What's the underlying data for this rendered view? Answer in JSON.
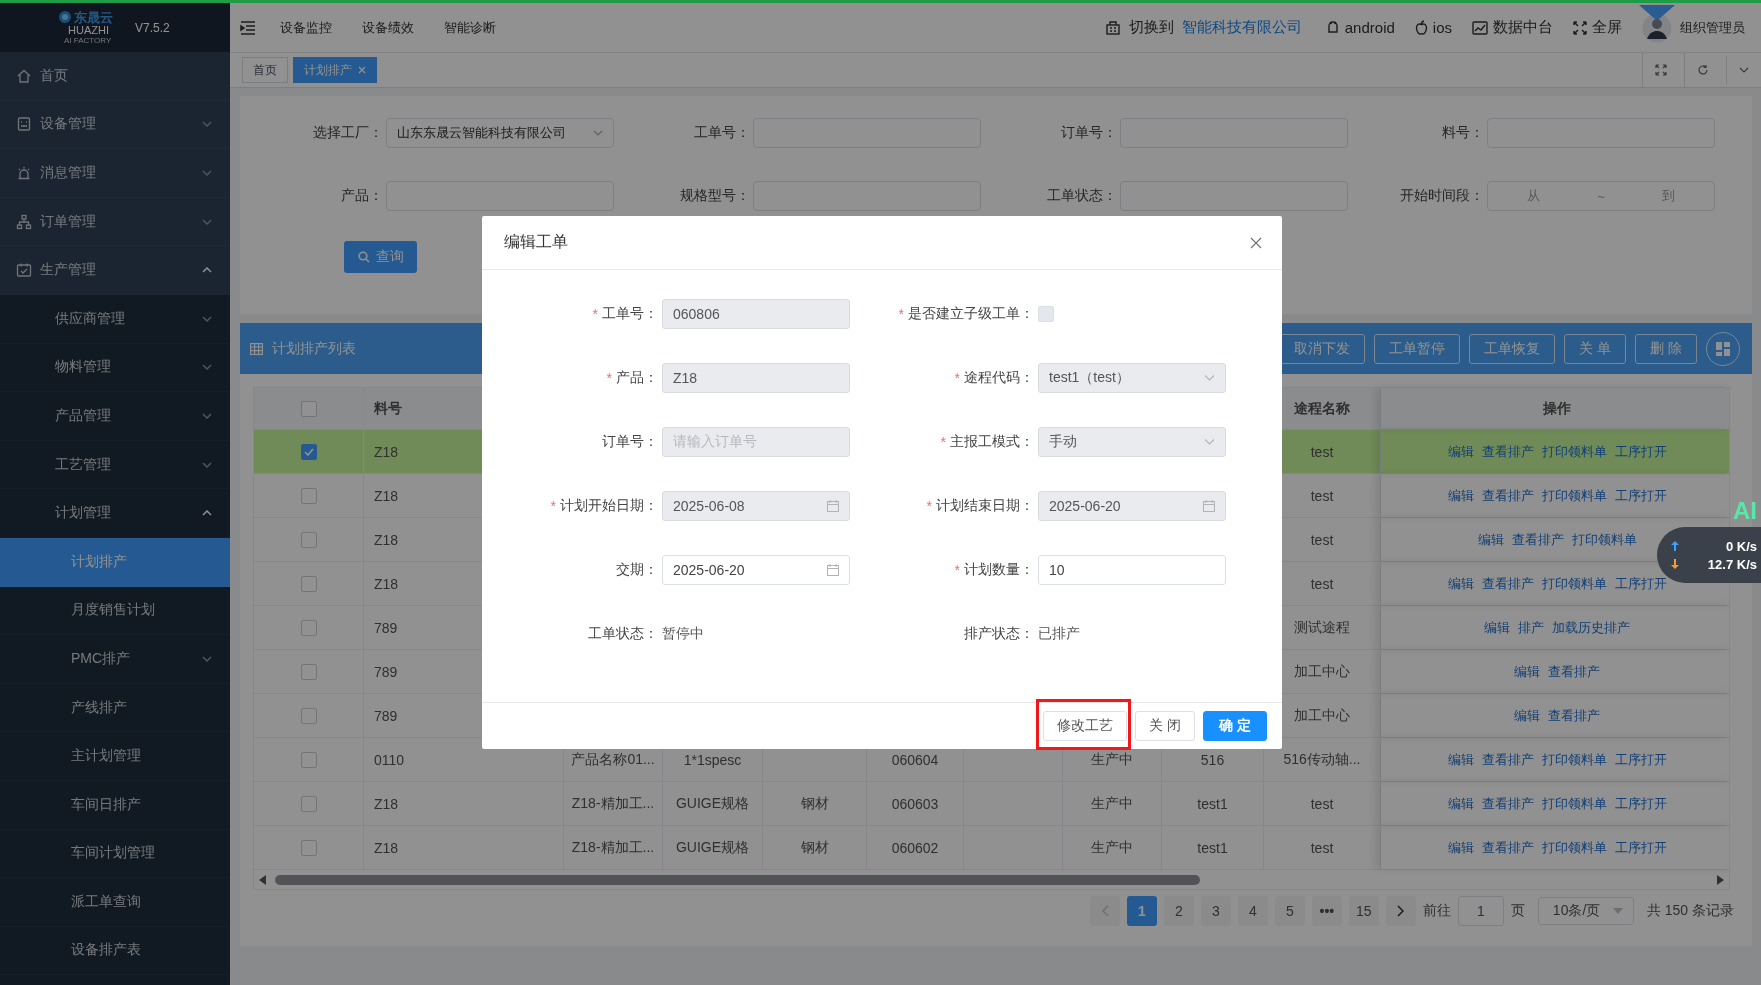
{
  "app": {
    "logo_text": "东晟云",
    "logo_sub": "HUAZHI",
    "logo_tag": "AI FACTORY",
    "version": "V7.5.2"
  },
  "top_nav": [
    {
      "label": "设备监控"
    },
    {
      "label": "设备绩效"
    },
    {
      "label": "智能诊断"
    }
  ],
  "header_right": {
    "switch_label": "切换到",
    "company": "智能科技有限公司",
    "items": [
      {
        "kind": "android",
        "label": "android"
      },
      {
        "kind": "apple",
        "label": "ios"
      },
      {
        "kind": "chart",
        "label": "数据中台"
      },
      {
        "kind": "fullscreen",
        "label": "全屏"
      }
    ],
    "user": "组织管理员"
  },
  "sidebar": [
    {
      "label": "首页",
      "kind": "home",
      "selected": false
    },
    {
      "label": "设备管理",
      "kind": "device",
      "selected": false,
      "expanded": false
    },
    {
      "label": "消息管理",
      "kind": "alarm",
      "selected": false,
      "expanded": false
    },
    {
      "label": "订单管理",
      "kind": "org",
      "selected": false,
      "expanded": false
    },
    {
      "label": "生产管理",
      "kind": "calendar",
      "selected": false,
      "expanded": true,
      "children": [
        {
          "label": "供应商管理",
          "selected": false,
          "expanded": false
        },
        {
          "label": "物料管理",
          "selected": false,
          "expanded": false
        },
        {
          "label": "产品管理",
          "selected": false,
          "expanded": false
        },
        {
          "label": "工艺管理",
          "selected": false,
          "expanded": false
        },
        {
          "label": "计划管理",
          "selected": false,
          "expanded": true,
          "children": [
            {
              "label": "计划排产",
              "selected": true
            },
            {
              "label": "月度销售计划",
              "selected": false
            },
            {
              "label": "PMC排产",
              "selected": false,
              "expanded": false
            },
            {
              "label": "产线排产",
              "selected": false
            },
            {
              "label": "主计划管理",
              "selected": false
            },
            {
              "label": "车间日排产",
              "selected": false
            },
            {
              "label": "车间计划管理",
              "selected": false
            },
            {
              "label": "派工单查询",
              "selected": false
            },
            {
              "label": "设备排产表",
              "selected": false
            }
          ]
        }
      ]
    }
  ],
  "tabs": [
    {
      "label": "首页",
      "selected": false,
      "closable": false
    },
    {
      "label": "计划排产",
      "selected": true,
      "closable": true
    }
  ],
  "filters": [
    {
      "label": "选择工厂：",
      "kind": "select",
      "value": "山东东晟云智能科技有限公司"
    },
    {
      "label": "工单号：",
      "kind": "input"
    },
    {
      "label": "订单号：",
      "kind": "input"
    },
    {
      "label": "料号：",
      "kind": "input"
    },
    {
      "label": "产品：",
      "kind": "input"
    },
    {
      "label": "规格型号：",
      "kind": "input"
    },
    {
      "label": "工单状态：",
      "kind": "input"
    },
    {
      "label": "开始时间段：",
      "kind": "range",
      "from": "从",
      "separator": "~",
      "to": "到"
    }
  ],
  "query_button": "查询",
  "table": {
    "title": "计划排产列表",
    "toolbar": [
      "取消下发",
      "工单暂停",
      "工单恢复",
      "关 单",
      "删 除"
    ],
    "header_checked": false,
    "columns": [
      {
        "kind": "text",
        "label": "料号"
      },
      {
        "kind": "text"
      },
      {
        "kind": "text"
      },
      {
        "kind": "text"
      },
      {
        "kind": "text"
      },
      {
        "kind": "text"
      },
      {
        "kind": "text"
      },
      {
        "kind": "text"
      },
      {
        "kind": "text",
        "label": "途程名称"
      },
      {
        "kind": "actions",
        "label": "操作"
      }
    ],
    "rows": [
      {
        "selected": true,
        "checked": true,
        "cells": [
          "Z18",
          null,
          null,
          null,
          null,
          null,
          null,
          null,
          "test"
        ],
        "actions": [
          "编辑",
          "查看排产",
          "打印领料单",
          "工序打开"
        ]
      },
      {
        "selected": false,
        "checked": false,
        "cells": [
          "Z18",
          null,
          null,
          null,
          null,
          null,
          null,
          null,
          "test"
        ],
        "actions": [
          "编辑",
          "查看排产",
          "打印领料单",
          "工序打开"
        ]
      },
      {
        "selected": false,
        "checked": false,
        "cells": [
          "Z18",
          null,
          null,
          null,
          null,
          null,
          null,
          null,
          "test"
        ],
        "actions": [
          "编辑",
          "查看排产",
          "打印领料单"
        ]
      },
      {
        "selected": false,
        "checked": false,
        "cells": [
          "Z18",
          null,
          null,
          null,
          null,
          null,
          null,
          null,
          "test"
        ],
        "actions": [
          "编辑",
          "查看排产",
          "打印领料单",
          "工序打开"
        ]
      },
      {
        "selected": false,
        "checked": false,
        "cells": [
          "789",
          null,
          null,
          null,
          null,
          null,
          null,
          null,
          "测试途程"
        ],
        "actions": [
          "编辑",
          "排产",
          "加载历史排产"
        ]
      },
      {
        "selected": false,
        "checked": false,
        "cells": [
          "789",
          null,
          null,
          null,
          null,
          null,
          null,
          null,
          "加工中心"
        ],
        "actions": [
          "编辑",
          "查看排产"
        ]
      },
      {
        "selected": false,
        "checked": false,
        "cells": [
          "789",
          null,
          null,
          null,
          null,
          null,
          null,
          null,
          "加工中心"
        ],
        "actions": [
          "编辑",
          "查看排产"
        ]
      },
      {
        "selected": false,
        "checked": false,
        "cells": [
          "0110",
          "产品名称01...",
          "1*1spesc",
          null,
          "060604",
          null,
          "生产中",
          "516",
          "516传动轴..."
        ],
        "actions": [
          "编辑",
          "查看排产",
          "打印领料单",
          "工序打开"
        ]
      },
      {
        "selected": false,
        "checked": false,
        "cells": [
          "Z18",
          "Z18-精加工...",
          "GUIGE规格",
          "钢材",
          "060603",
          null,
          "生产中",
          "test1",
          "test"
        ],
        "actions": [
          "编辑",
          "查看排产",
          "打印领料单",
          "工序打开"
        ]
      },
      {
        "selected": false,
        "checked": false,
        "cells": [
          "Z18",
          "Z18-精加工...",
          "GUIGE规格",
          "钢材",
          "060602",
          null,
          "生产中",
          "test1",
          "test"
        ],
        "actions": [
          "编辑",
          "查看排产",
          "打印领料单",
          "工序打开"
        ]
      }
    ]
  },
  "pagination": {
    "pages": [
      {
        "kind": "page",
        "label": "1",
        "selected": true
      },
      {
        "kind": "page",
        "label": "2",
        "selected": false
      },
      {
        "kind": "page",
        "label": "3",
        "selected": false
      },
      {
        "kind": "page",
        "label": "4",
        "selected": false
      },
      {
        "kind": "page",
        "label": "5",
        "selected": false
      },
      {
        "kind": "more",
        "label": "•••",
        "selected": false
      },
      {
        "kind": "page",
        "label": "15",
        "selected": false
      }
    ],
    "goto_label": "前往",
    "goto_value": "1",
    "goto_unit": "页",
    "page_size": "10条/页",
    "total": "共 150 条记录"
  },
  "dialog": {
    "title": "编辑工单",
    "fields": [
      {
        "label": "工单号：",
        "required_mark": "*",
        "kind": "input",
        "value": "060806",
        "disabled": true
      },
      {
        "label": "是否建立子级工单：",
        "required_mark": "*",
        "kind": "checkbox",
        "checked": false,
        "disabled": true
      },
      {
        "label": "产品：",
        "required_mark": "*",
        "kind": "input",
        "value": "Z18",
        "disabled": true
      },
      {
        "label": "途程代码：",
        "required_mark": "*",
        "kind": "select",
        "value": "test1（test）",
        "disabled": true
      },
      {
        "label": "订单号：",
        "kind": "input",
        "placeholder": "请输入订单号",
        "disabled": true
      },
      {
        "label": "主报工模式：",
        "required_mark": "*",
        "kind": "select",
        "value": "手动",
        "disabled": true
      },
      {
        "label": "计划开始日期：",
        "required_mark": "*",
        "kind": "date",
        "value": "2025-06-08",
        "disabled": true
      },
      {
        "label": "计划结束日期：",
        "required_mark": "*",
        "kind": "date",
        "value": "2025-06-20",
        "disabled": true
      },
      {
        "label": "交期：",
        "kind": "date",
        "value": "2025-06-20",
        "disabled": false
      },
      {
        "label": "计划数量：",
        "required_mark": "*",
        "kind": "input",
        "value": "10",
        "disabled": false
      },
      {
        "label": "工单状态：",
        "kind": "text",
        "value": "暂停中"
      },
      {
        "label": "排产状态：",
        "kind": "text",
        "value": "已排产"
      }
    ],
    "buttons": [
      {
        "label": "修改工艺",
        "kind": "default",
        "annotated": true
      },
      {
        "label": "关 闭",
        "kind": "default",
        "annotated": false
      },
      {
        "label": "确 定",
        "kind": "primary",
        "annotated": false
      }
    ]
  },
  "net_widget": {
    "ai_label": "AI",
    "upload": "0 K/s",
    "download": "12.7 K/s"
  }
}
